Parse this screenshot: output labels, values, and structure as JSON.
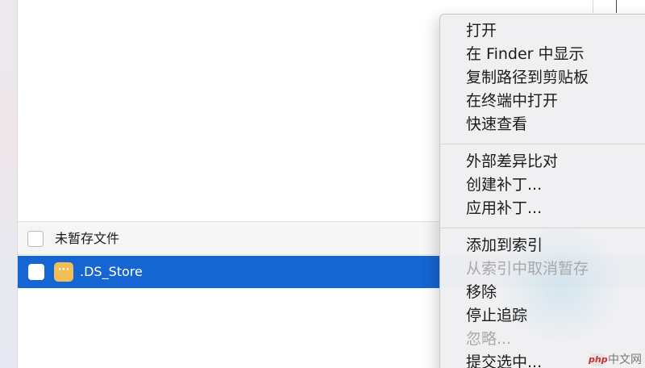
{
  "file_list": {
    "section_label": "未暂存文件",
    "selected_file": {
      "name": ".DS_Store",
      "icon": "ellipsis-file-icon",
      "icon_glyph": "···"
    }
  },
  "context_menu": {
    "groups": [
      [
        "打开",
        "在 Finder 中显示",
        "复制路径到剪贴板",
        "在终端中打开",
        "快速查看"
      ],
      [
        "外部差异比对",
        "创建补丁...",
        "应用补丁..."
      ],
      [
        "添加到索引",
        "从索引中取消暂存",
        "移除",
        "停止追踪",
        "忽略...",
        "提交选中..."
      ]
    ],
    "items": [
      {
        "label": "打开",
        "enabled": true
      },
      {
        "label": "在 Finder 中显示",
        "enabled": true
      },
      {
        "label": "复制路径到剪贴板",
        "enabled": true
      },
      {
        "label": "在终端中打开",
        "enabled": true
      },
      {
        "label": "快速查看",
        "enabled": true
      },
      {
        "label": "外部差异比对",
        "enabled": true
      },
      {
        "label": "创建补丁...",
        "enabled": true
      },
      {
        "label": "应用补丁...",
        "enabled": true
      },
      {
        "label": "添加到索引",
        "enabled": true
      },
      {
        "label": "从索引中取消暂存",
        "enabled": false
      },
      {
        "label": "移除",
        "enabled": true
      },
      {
        "label": "停止追踪",
        "enabled": true
      },
      {
        "label": "忽略...",
        "enabled": false
      },
      {
        "label": "提交选中...",
        "enabled": true
      }
    ]
  },
  "watermark": {
    "logo": "php",
    "text": "中文网"
  },
  "colors": {
    "selection": "#1565d2",
    "file_icon": "#f3be54",
    "menu_background": "#f0f0f2",
    "disabled_text": "#a9a9a9"
  }
}
